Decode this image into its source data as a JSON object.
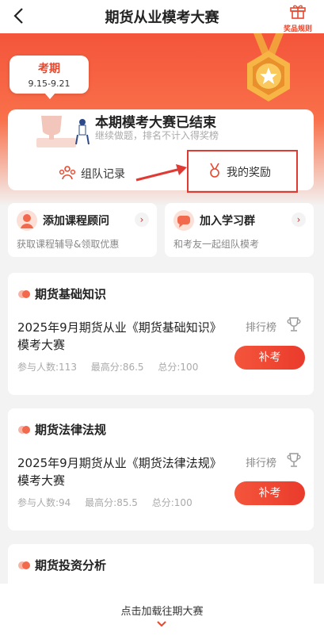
{
  "header": {
    "title": "期货从业模考大赛",
    "rules_label": "奖品规则"
  },
  "period": {
    "label": "考期",
    "range": "9.15-9.21"
  },
  "status": {
    "title": "本期模考大赛已结束",
    "subtitle": "继续做题，排名不计入得奖榜"
  },
  "actions": {
    "team_record": "组队记录",
    "my_reward": "我的奖励"
  },
  "promos": [
    {
      "title": "添加课程顾问",
      "subtitle": "获取课程辅导&领取优惠"
    },
    {
      "title": "加入学习群",
      "subtitle": "和考友一起组队模考"
    }
  ],
  "exams": [
    {
      "section": "期货基础知识",
      "name": "2025年9月期货从业《期货基础知识》模考大赛",
      "participants": "参与人数:113",
      "highest": "最高分:86.5",
      "total": "总分:100",
      "rank_label": "排行榜",
      "button": "补考"
    },
    {
      "section": "期货法律法规",
      "name": "2025年9月期货从业《期货法律法规》模考大赛",
      "participants": "参与人数:94",
      "highest": "最高分:85.5",
      "total": "总分:100",
      "rank_label": "排行榜",
      "button": "补考"
    },
    {
      "section": "期货投资分析"
    }
  ],
  "footer": {
    "load_more": "点击加载往期大赛"
  },
  "colors": {
    "accent": "#f4553b",
    "highlight_border": "#e03a35"
  },
  "icons": [
    "back-icon",
    "gift-icon",
    "medal-icon",
    "team-icon",
    "reward-icon",
    "trophy-icon",
    "chevron-right-icon",
    "chevron-down-icon"
  ]
}
